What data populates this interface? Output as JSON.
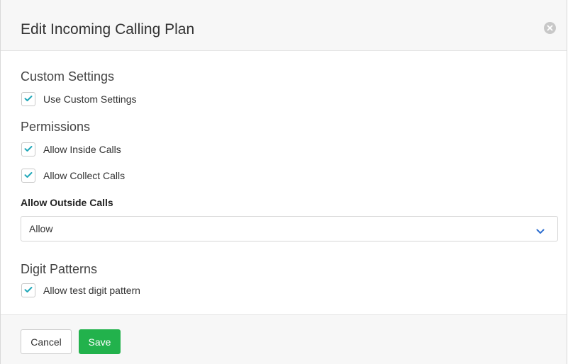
{
  "dialog": {
    "title": "Edit Incoming Calling Plan",
    "close_icon": "close-circle-icon"
  },
  "sections": {
    "custom_settings": {
      "title": "Custom Settings",
      "use_custom_settings": {
        "label": "Use Custom Settings",
        "checked": true
      }
    },
    "permissions": {
      "title": "Permissions",
      "allow_inside_calls": {
        "label": "Allow Inside Calls",
        "checked": true
      },
      "allow_collect_calls": {
        "label": "Allow Collect Calls",
        "checked": true
      }
    },
    "outside_calls": {
      "label": "Allow Outside Calls",
      "selected_value": "Allow",
      "chevron_icon": "chevron-down-icon"
    },
    "digit_patterns": {
      "title": "Digit Patterns",
      "allow_test_digit_pattern": {
        "label": "Allow test digit pattern",
        "checked": true
      }
    }
  },
  "footer": {
    "cancel_label": "Cancel",
    "save_label": "Save"
  },
  "colors": {
    "accent_check": "#1fa7b8",
    "save_button": "#22b24c",
    "chevron": "#2f6fd0",
    "header_bg": "#f7f7f7"
  }
}
